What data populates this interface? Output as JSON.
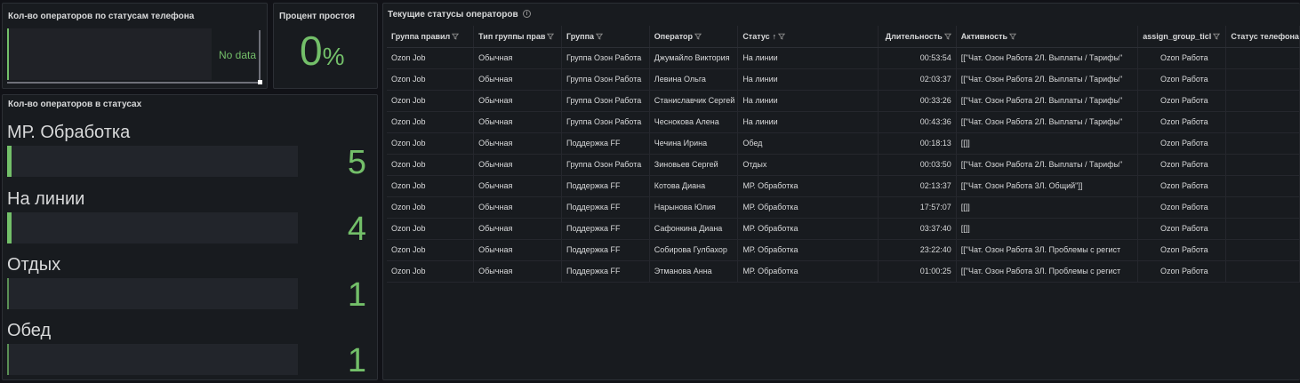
{
  "panel_phone": {
    "title": "Кол-во операторов по статусам телефона",
    "no_data": "No data"
  },
  "panel_idle": {
    "title": "Процент простоя",
    "value": "0",
    "unit": "%"
  },
  "panel_statuses": {
    "title": "Кол-во операторов в статусах",
    "items": [
      {
        "label": "МР. Обработка",
        "value": "5"
      },
      {
        "label": "На линии",
        "value": "4"
      },
      {
        "label": "Отдых",
        "value": "1"
      },
      {
        "label": "Обед",
        "value": "1"
      }
    ]
  },
  "panel_table": {
    "title": "Текущие статусы операторов",
    "info_icon": "info-icon",
    "columns": [
      "Группа правил",
      "Тип группы прав",
      "Группа",
      "Оператор",
      "Статус",
      "Длительность",
      "Активность",
      "assign_group_ticl",
      "Статус телефона"
    ],
    "rows": [
      [
        "Ozon Job",
        "Обычная",
        "Группа Озон Работа",
        "Джумайло Виктория",
        "На линии",
        "00:53:54",
        "[[\"Чат. Озон Работа 2Л. Выплаты / Тарифы\"",
        "Ozon Работа"
      ],
      [
        "Ozon Job",
        "Обычная",
        "Группа Озон Работа",
        "Левина Ольга",
        "На линии",
        "02:03:37",
        "[[\"Чат. Озон Работа 2Л. Выплаты / Тарифы\"",
        "Ozon Работа"
      ],
      [
        "Ozon Job",
        "Обычная",
        "Группа Озон Работа",
        "Станиславчик Сергей",
        "На линии",
        "00:33:26",
        "[[\"Чат. Озон Работа 2Л. Выплаты / Тарифы\"",
        "Ozon Работа"
      ],
      [
        "Ozon Job",
        "Обычная",
        "Группа Озон Работа",
        "Чеснокова Алена",
        "На линии",
        "00:43:36",
        "[[\"Чат. Озон Работа 2Л. Выплаты / Тарифы\"",
        "Ozon Работа"
      ],
      [
        "Ozon Job",
        "Обычная",
        "Поддержка FF",
        "Чечина Ирина",
        "Обед",
        "00:18:13",
        "[[]]",
        "Ozon Работа"
      ],
      [
        "Ozon Job",
        "Обычная",
        "Группа Озон Работа",
        "Зиновьев Сергей",
        "Отдых",
        "00:03:50",
        "[[\"Чат. Озон Работа 2Л. Выплаты / Тарифы\"",
        "Ozon Работа"
      ],
      [
        "Ozon Job",
        "Обычная",
        "Поддержка FF",
        "Котова Диана",
        "МР. Обработка",
        "02:13:37",
        "[[\"Чат. Озон Работа 3Л. Общий\"]]",
        "Ozon Работа"
      ],
      [
        "Ozon Job",
        "Обычная",
        "Поддержка FF",
        "Нарынова Юлия",
        "МР. Обработка",
        "17:57:07",
        "[[]]",
        "Ozon Работа"
      ],
      [
        "Ozon Job",
        "Обычная",
        "Поддержка FF",
        "Сафонкина Диана",
        "МР. Обработка",
        "03:37:40",
        "[[]]",
        "Ozon Работа"
      ],
      [
        "Ozon Job",
        "Обычная",
        "Поддержка FF",
        "Собирова Гулбахор",
        "МР. Обработка",
        "23:22:40",
        "[[\"Чат. Озон Работа 3Л. Проблемы с регист",
        "Ozon Работа"
      ],
      [
        "Ozon Job",
        "Обычная",
        "Поддержка FF",
        "Этманова Анна",
        "МР. Обработка",
        "01:00:25",
        "[[\"Чат. Озон Работа 3Л. Проблемы с регист",
        "Ozon Работа"
      ]
    ]
  },
  "colors": {
    "accent": "#73bf69",
    "background": "#111217",
    "panel": "#181b1f"
  }
}
